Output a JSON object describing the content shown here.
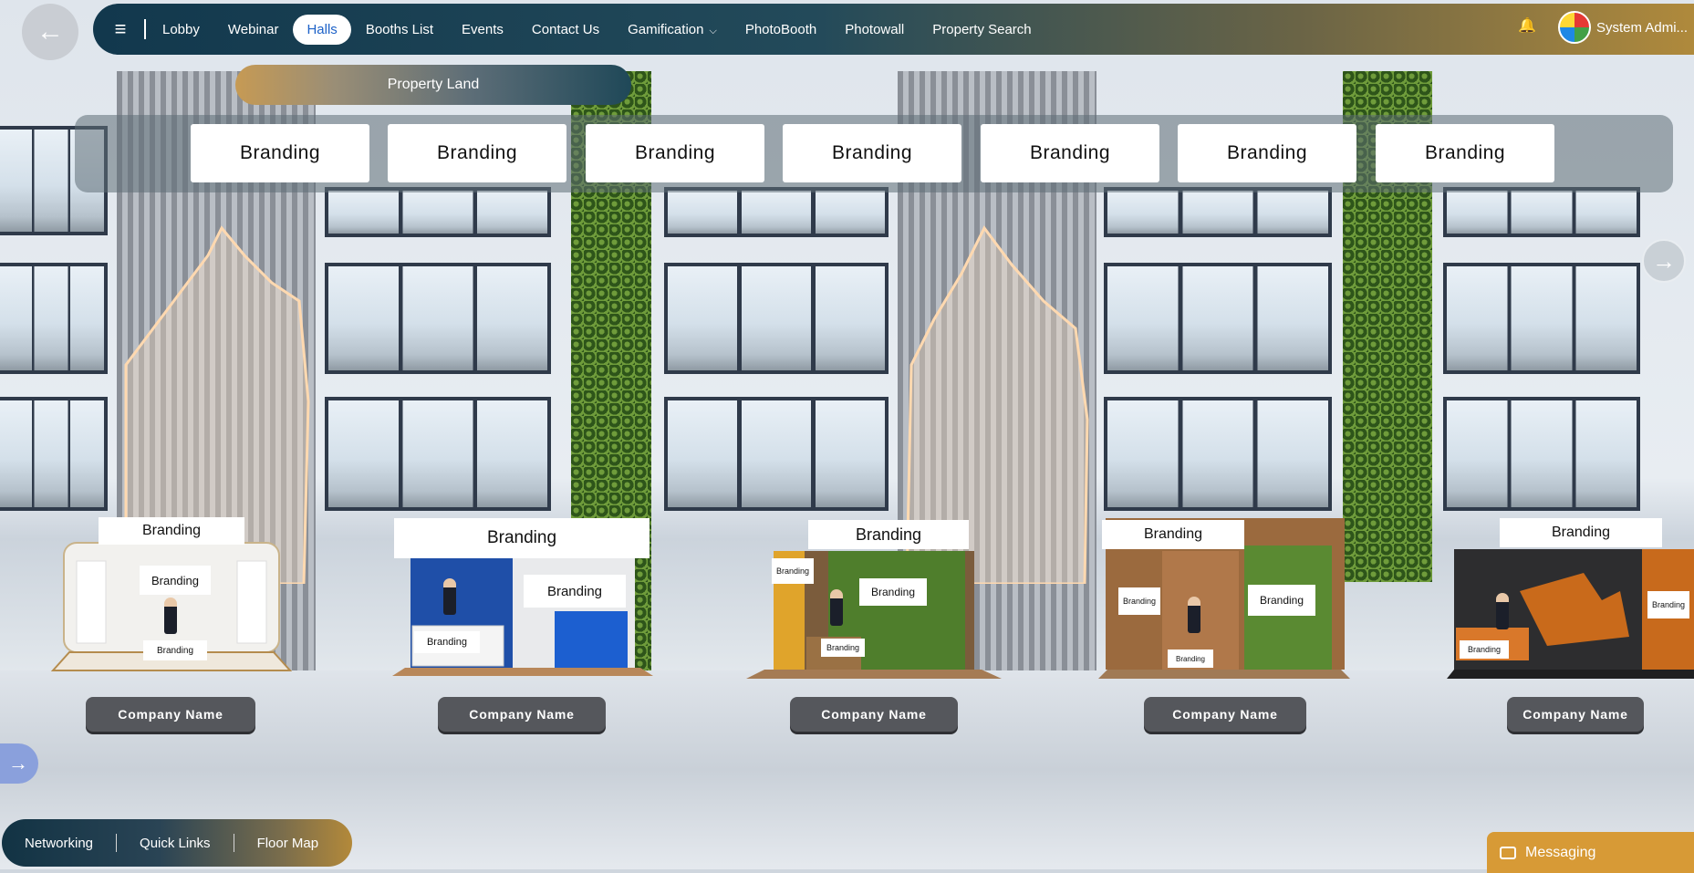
{
  "nav": {
    "items": [
      {
        "label": "Lobby"
      },
      {
        "label": "Webinar"
      },
      {
        "label": "Halls"
      },
      {
        "label": "Booths List"
      },
      {
        "label": "Events"
      },
      {
        "label": "Contact Us"
      },
      {
        "label": "Gamification"
      },
      {
        "label": "PhotoBooth"
      },
      {
        "label": "Photowall"
      },
      {
        "label": "Property Search"
      }
    ],
    "active": "Halls",
    "user_name": "System Admi..."
  },
  "hall": {
    "title": "Property Land",
    "top_banners": [
      "Branding",
      "Branding",
      "Branding",
      "Branding",
      "Branding",
      "Branding",
      "Branding"
    ]
  },
  "booths": [
    {
      "branding": "Branding",
      "company": "Company Name"
    },
    {
      "branding": "Branding",
      "company": "Company Name"
    },
    {
      "branding": "Branding",
      "company": "Company Name"
    },
    {
      "branding": "Branding",
      "company": "Company Name"
    },
    {
      "branding": "Branding",
      "company": "Company Name"
    }
  ],
  "bottom_nav": {
    "networking": "Networking",
    "quick_links": "Quick Links",
    "floor_map": "Floor Map"
  },
  "messaging": "Messaging",
  "colors": {
    "nav_start": "#12384d",
    "nav_end": "#b08a3c",
    "active_tab_text": "#1d62c8",
    "messaging_bg": "#d79a36",
    "company_btn": "#55575c"
  }
}
